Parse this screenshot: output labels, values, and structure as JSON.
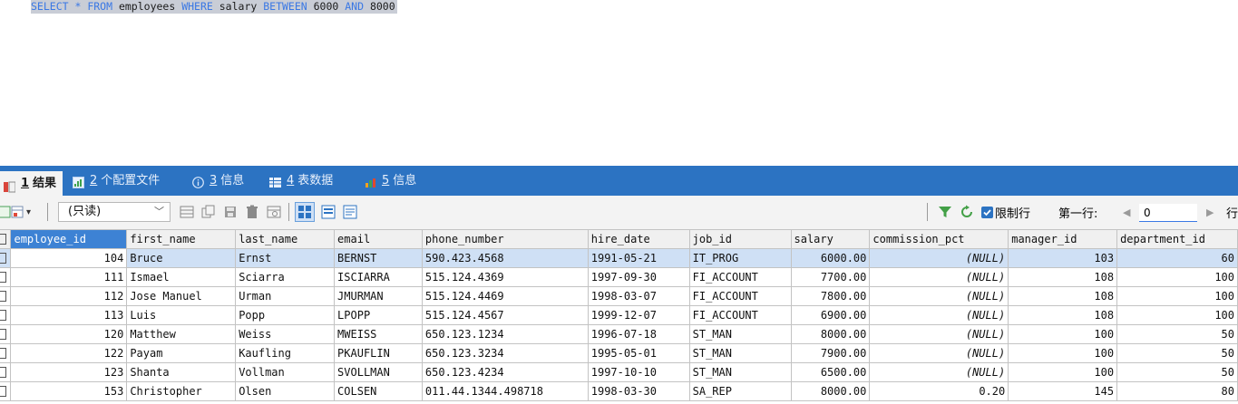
{
  "editor": {
    "sql_tokens": [
      {
        "t": "SELECT",
        "k": "kw"
      },
      {
        "t": " * ",
        "k": "kw"
      },
      {
        "t": "FROM",
        "k": "kw"
      },
      {
        "t": " employees ",
        "k": "id"
      },
      {
        "t": "WHERE",
        "k": "kw"
      },
      {
        "t": " salary ",
        "k": "id"
      },
      {
        "t": "BETWEEN",
        "k": "kw"
      },
      {
        "t": " 6000 ",
        "k": "num"
      },
      {
        "t": "AND",
        "k": "kw"
      },
      {
        "t": " 8000",
        "k": "num"
      }
    ]
  },
  "tabs": [
    {
      "num": "1",
      "label": "结果",
      "icon": "result-grid-icon"
    },
    {
      "num": "2",
      "label": "个配置文件",
      "icon": "profile-icon"
    },
    {
      "num": "3",
      "label": "信息",
      "icon": "info-icon"
    },
    {
      "num": "4",
      "label": "表数据",
      "icon": "table-data-icon"
    },
    {
      "num": "5",
      "label": "信息",
      "icon": "chart-info-icon"
    }
  ],
  "toolbar": {
    "mode": "(只读)",
    "limit_rows_label": "限制行",
    "limit_rows_checked": true,
    "first_row_label": "第一行:",
    "first_row_value": "0",
    "rows_label": "行"
  },
  "colors": {
    "tabbar": "#2c73c2",
    "accent": "#3d82d4",
    "keyword": "#3a78e4",
    "selected_row": "#cfe0f5"
  },
  "grid": {
    "columns": [
      "employee_id",
      "first_name",
      "last_name",
      "email",
      "phone_number",
      "hire_date",
      "job_id",
      "salary",
      "commission_pct",
      "manager_id",
      "department_id"
    ],
    "right_aligned": [
      0,
      7,
      8,
      9,
      10
    ],
    "rows": [
      [
        "104",
        "Bruce",
        "Ernst",
        "BERNST",
        "590.423.4568",
        "1991-05-21",
        "IT_PROG",
        "6000.00",
        "(NULL)",
        "103",
        "60"
      ],
      [
        "111",
        "Ismael",
        "Sciarra",
        "ISCIARRA",
        "515.124.4369",
        "1997-09-30",
        "FI_ACCOUNT",
        "7700.00",
        "(NULL)",
        "108",
        "100"
      ],
      [
        "112",
        "Jose Manuel",
        "Urman",
        "JMURMAN",
        "515.124.4469",
        "1998-03-07",
        "FI_ACCOUNT",
        "7800.00",
        "(NULL)",
        "108",
        "100"
      ],
      [
        "113",
        "Luis",
        "Popp",
        "LPOPP",
        "515.124.4567",
        "1999-12-07",
        "FI_ACCOUNT",
        "6900.00",
        "(NULL)",
        "108",
        "100"
      ],
      [
        "120",
        "Matthew",
        "Weiss",
        "MWEISS",
        "650.123.1234",
        "1996-07-18",
        "ST_MAN",
        "8000.00",
        "(NULL)",
        "100",
        "50"
      ],
      [
        "122",
        "Payam",
        "Kaufling",
        "PKAUFLIN",
        "650.123.3234",
        "1995-05-01",
        "ST_MAN",
        "7900.00",
        "(NULL)",
        "100",
        "50"
      ],
      [
        "123",
        "Shanta",
        "Vollman",
        "SVOLLMAN",
        "650.123.4234",
        "1997-10-10",
        "ST_MAN",
        "6500.00",
        "(NULL)",
        "100",
        "50"
      ],
      [
        "153",
        "Christopher",
        "Olsen",
        "COLSEN",
        "011.44.1344.498718",
        "1998-03-30",
        "SA_REP",
        "8000.00",
        "0.20",
        "145",
        "80"
      ]
    ]
  }
}
